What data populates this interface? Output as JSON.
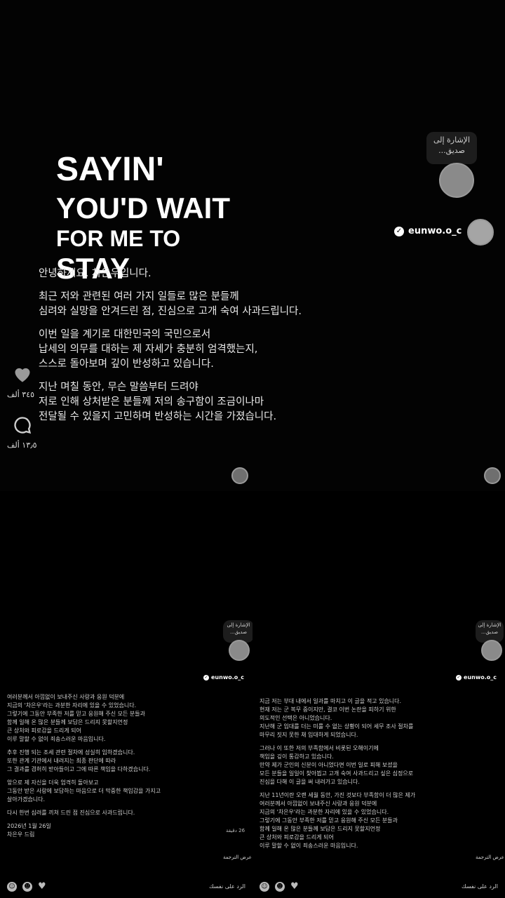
{
  "overlay": {
    "line1": "SAYIN'",
    "line2": "YOU'D WAIT",
    "line3": "FOR ME TO",
    "line4": "STAY"
  },
  "top_story": {
    "mention_bubble": "الإشارة إلى\nصديق...",
    "username": "eunwo.o_c",
    "like_count": "٣٤٥ ألف",
    "comment_count": "١٣٫٥ ألف",
    "paragraphs": [
      "안녕하세요. 차은우입니다.",
      "최근 저와 관련된 여러 가지 일들로 많은 분들께\n심려와 실망을 안겨드린 점, 진심으로 고개 숙여 사과드립니다.",
      "이번 일을 계기로 대한민국의 국민으로서\n납세의 의무를 대하는 제 자세가 충분히 엄격했는지,\n스스로 돌아보며 깊이 반성하고 있습니다.",
      "지난 며칠 동안, 무슨 말씀부터 드려야\n저로 인해 상처받은 분들께 저의 송구함이 조금이나마\n전달될 수 있을지 고민하며 반성하는 시간을 가졌습니다."
    ]
  },
  "left_story": {
    "mention_bubble": "الإشارة إلى\nصديق...",
    "username": "eunwo.o_c",
    "paragraphs": [
      "여러분께서 아낌없이 보내주신 사랑과 응원 덕분에\n지금의 '차은우'라는 과분한 자리에 있을 수 있었습니다.\n그렇기에 그동안 부족한 저를 믿고 응원해 주신 모든 분들과\n함께 일해 온 많은 분들께 보답은 드리지 못할지언정\n큰 상처와 피로감을 드리게 되어\n이루 말할 수 없이 죄송스러운 마음입니다.",
      "추후 진행 되는 조세 관련 절차에 성실히 임하겠습니다.\n또한 관계 기관에서 내려지는 최종 판단에 따라\n그 결과를 겸허히 받아들이고 그에 따른 책임을 다하겠습니다.",
      "앞으로 제 자신을 더욱 엄격히 돌아보고\n그동안 받은 사랑에 보답하는 마음으로 더 막중한 책임감을 가지고\n살아가겠습니다.",
      "다시 한번 심려를 끼쳐 드린 점 진심으로 사과드립니다.",
      "2026년 1월 26일\n차은우 드림"
    ],
    "time": "26 دقيقة",
    "translation": "عرض الترجمة",
    "reply": "الرد على نفسك"
  },
  "right_story": {
    "mention_bubble": "الإشارة إلى\nصديق...",
    "username": "eunwo.o_c",
    "paragraphs": [
      "지금 저는 부대 내에서 일과를 마치고 이 글을 적고 있습니다.\n현재 저는 군 복무 중이지만, 결코 이번 논란을 피하기 위한\n의도적인 선택은 아니었습니다.\n지난해 군 입대를 더는 미룰 수 없는 상황이 되어 세무 조사 절차를\n마무리 짓지 못한 채 입대하게 되었습니다.",
      "그러나 이 또한 저의 부족함에서 비롯된 오해이기에\n책임을 깊이 통감하고 있습니다.\n만약 제가 군인의 신분이 아니었다면 이번 일로 피해 보셨을\n모든 분들을 일일이 찾아뵙고 고개 숙여 사과드리고 싶은 심정으로\n진심을 다해 이 글을 써 내려가고 있습니다.",
      "지난 11년이란 오랜 세월 동안, 가진 것보다 부족함이 더 많은 제가\n여러분께서 아낌없이 보내주신 사랑과 응원 덕분에\n지금의 '차은우'라는 과분한 자리에 있을 수 있었습니다.\n그렇기에 그동안 부족한 저를 믿고 응원해 주신 모든 분들과\n함께 일해 온 많은 분들께 보답은 드리지 못할지언정\n큰 상처와 피로감을 드리게 되어\n이루 말할 수 없이 죄송스러운 마음입니다."
    ],
    "translation": "عرض الترجمة",
    "reply": "الرد على نفسك"
  }
}
